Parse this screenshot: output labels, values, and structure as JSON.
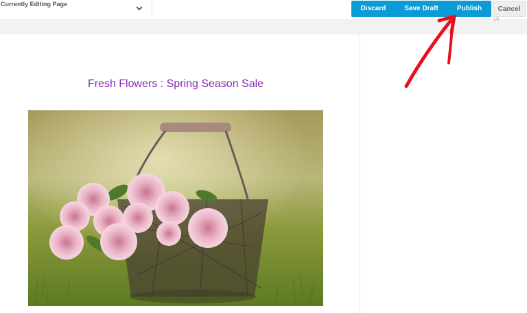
{
  "toolbar": {
    "page_select_label": "Currently Editing Page",
    "discard_label": "Discard",
    "save_draft_label": "Save Draft",
    "publish_label": "Publish",
    "cancel_label": "Cancel",
    "accent_color": "#0b9bd6"
  },
  "subbar": {
    "tiny_text": "1/0"
  },
  "content": {
    "heading": "Fresh Flowers : Spring Season Sale",
    "heading_color": "#8a2ab8",
    "image_subject": "basket of pink roses on grass"
  },
  "annotation": {
    "arrow_color": "#e8101a",
    "arrow_target": "Publish"
  }
}
